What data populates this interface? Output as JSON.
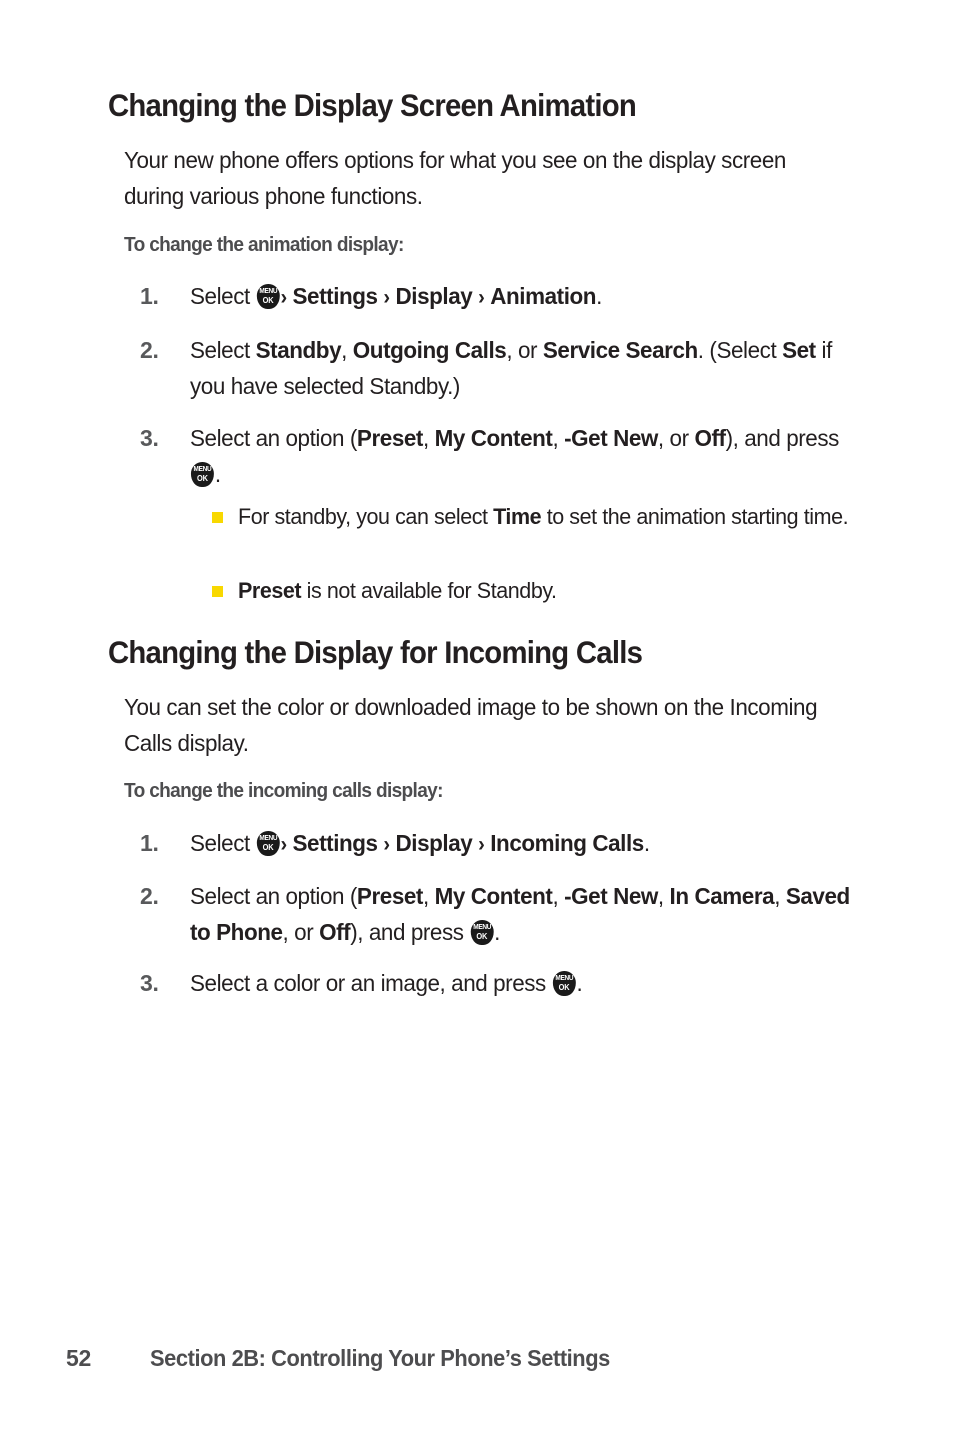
{
  "page": {
    "background_color": "#ffffff",
    "text_color": "#231f20",
    "muted_text_color": "#4d4d4f",
    "bullet_color": "#f8d800"
  },
  "icons": {
    "menu_ok": {
      "top_label": "MENU",
      "bottom_label": "OK",
      "name": "menu-ok-key-icon"
    },
    "chevron": "›"
  },
  "sections": [
    {
      "heading": "Changing the Display Screen Animation",
      "paragraph": "Your new phone offers options for what you see on the display screen during various phone functions.",
      "lead_in": "To change the animation display:",
      "steps": [
        {
          "number": "1.",
          "prefix": "Select ",
          "suffix_bold": "Settings",
          "path": [
            "Settings",
            "Display",
            "Animation"
          ]
        },
        {
          "number": "2.",
          "text": "Select Standby, Outgoing Calls, or Service Search. (Select Set if you have selected Standby.)"
        },
        {
          "number": "3.",
          "text": "Select an option (Preset, My Content, -Get New, or Off), and press ."
        }
      ],
      "sub_bullets": [
        {
          "text": "For standby, you can select Time to set the animation starting time."
        },
        {
          "text": "Preset is not available for Standby."
        }
      ]
    },
    {
      "heading": "Changing the Display for Incoming Calls",
      "paragraph": "You can set the color or downloaded image to be shown on the Incoming Calls display.",
      "lead_in": "To change the incoming calls display:",
      "steps": [
        {
          "number": "1.",
          "path": [
            "Settings",
            "Display",
            "Incoming Calls"
          ]
        },
        {
          "number": "2.",
          "text": "Select an option (Preset, My Content, -Get New, In Camera, Saved to Phone, or Off), and press ."
        },
        {
          "number": "3.",
          "text": "Select a color or an image, and press ."
        }
      ]
    }
  ],
  "text": {
    "s1_heading": "Changing the Display Screen Animation",
    "s1_paragraph": "Your new phone offers options for what you see on the display screen during various phone functions.",
    "s1_leadin": "To change the animation display:",
    "s1_step1_num": "1.",
    "s1_step1_a": "Select ",
    "s1_step1_chev1": "›",
    "s1_step1_b": "Settings",
    "s1_step1_chev2": "›",
    "s1_step1_c": "Display",
    "s1_step1_chev3": "›",
    "s1_step1_d": "Animation",
    "s1_step1_e": ".",
    "s1_step2_num": "2.",
    "s1_step2_a": "Select ",
    "s1_step2_b": "Standby",
    "s1_step2_c": ", ",
    "s1_step2_d": "Outgoing Calls",
    "s1_step2_e": ", or ",
    "s1_step2_f": "Service Search",
    "s1_step2_g": ". (Select ",
    "s1_step2_h": "Set",
    "s1_step2_i": " if you have selected Standby.)",
    "s1_step3_num": "3.",
    "s1_step3_a": "Select an option (",
    "s1_step3_b": "Preset",
    "s1_step3_c": ", ",
    "s1_step3_d": "My Content",
    "s1_step3_e": ", ",
    "s1_step3_f": "-Get New",
    "s1_step3_g": ", or ",
    "s1_step3_h": "Off",
    "s1_step3_i": "), and press ",
    "s1_step3_j": ".",
    "s1_bullet1_a": "For standby, you can select ",
    "s1_bullet1_b": "Time",
    "s1_bullet1_c": " to set the animation starting time.",
    "s1_bullet2_a": "Preset",
    "s1_bullet2_b": " is not available for Standby.",
    "s2_heading": "Changing the Display for Incoming Calls",
    "s2_paragraph": "You can set the color or downloaded image to be shown on the Incoming Calls display.",
    "s2_leadin": "To change the incoming calls display:",
    "s2_step1_num": "1.",
    "s2_step1_a": "Select ",
    "s2_step1_chev1": "›",
    "s2_step1_b": "Settings",
    "s2_step1_chev2": "›",
    "s2_step1_c": "Display",
    "s2_step1_chev3": "›",
    "s2_step1_d": "Incoming Calls",
    "s2_step1_e": ".",
    "s2_step2_num": "2.",
    "s2_step2_a": "Select an option (",
    "s2_step2_b": "Preset",
    "s2_step2_c": ", ",
    "s2_step2_d": "My Content",
    "s2_step2_e": ", ",
    "s2_step2_f": "-Get New",
    "s2_step2_g": ", ",
    "s2_step2_h": "In Camera",
    "s2_step2_i": ", ",
    "s2_step2_j": "Saved to Phone",
    "s2_step2_k": ", or ",
    "s2_step2_l": "Off",
    "s2_step2_m": "), and press ",
    "s2_step2_n": ".",
    "s2_step3_num": "3.",
    "s2_step3_a": "Select a color or an image, and press ",
    "s2_step3_b": ".",
    "menu_top": "MENU",
    "menu_bottom": "OK",
    "footer_page": "52",
    "footer_title": "Section 2B: Controlling Your Phone’s Settings"
  }
}
